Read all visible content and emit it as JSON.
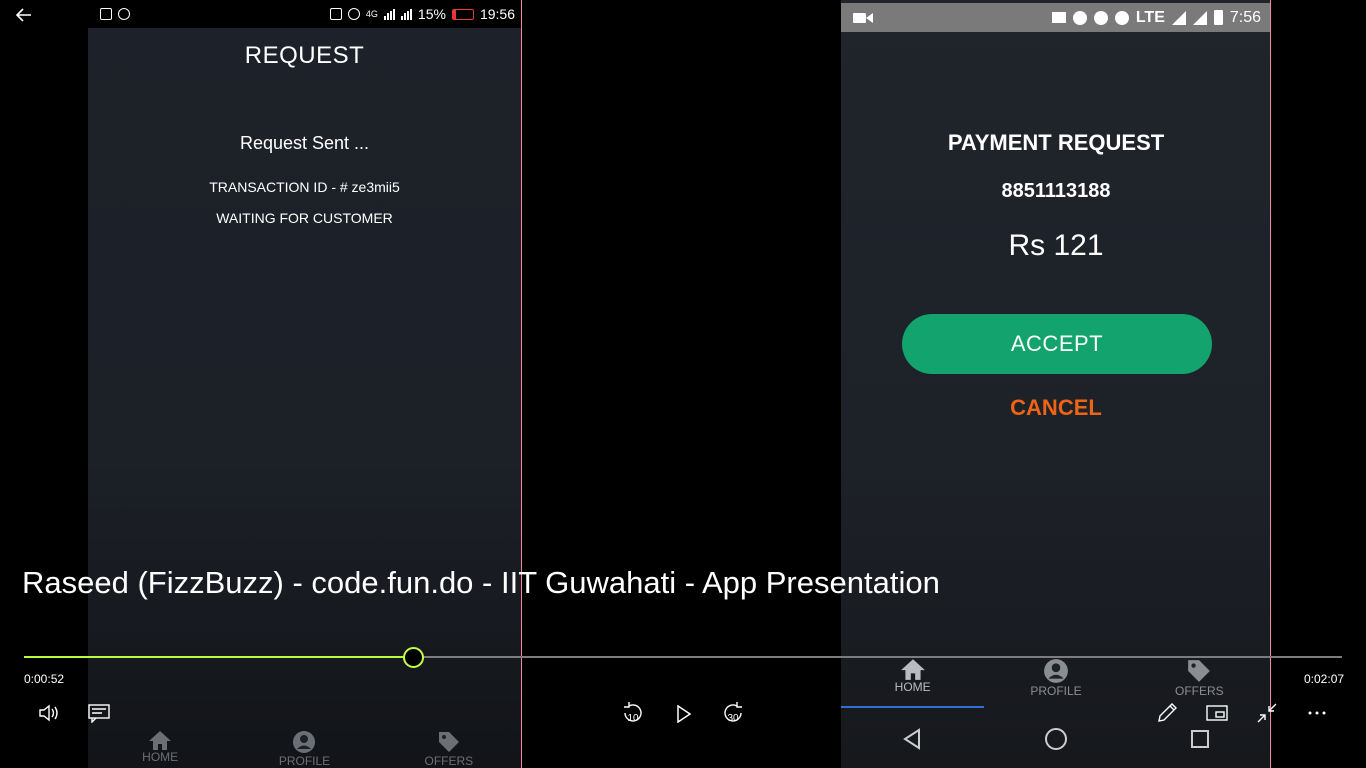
{
  "player": {
    "back_icon": "arrow-left-icon",
    "title": "Raseed (FizzBuzz) - code.fun.do - IIT Guwahati - App Presentation",
    "time_elapsed": "0:00:52",
    "time_total": "0:02:07",
    "progress_fraction": 0.2955,
    "accent_color": "#b6ff3c",
    "rewind_seconds": "10",
    "forward_seconds": "30",
    "controls": [
      "volume-icon",
      "captions-icon",
      "rewind-10-icon",
      "play-icon",
      "forward-30-icon",
      "pen-icon",
      "mini-view-icon",
      "exit-fullscreen-icon",
      "more-icon"
    ]
  },
  "left_phone": {
    "status": {
      "battery": "15%",
      "time": "19:56",
      "network": "4G"
    },
    "title": "REQUEST",
    "sent_text": "Request Sent ...",
    "transaction": "TRANSACTION ID - # ze3mii5",
    "waiting": "WAITING FOR CUSTOMER",
    "nav": [
      "HOME",
      "PROFILE",
      "OFFERS"
    ]
  },
  "right_phone": {
    "status": {
      "time": "7:56",
      "network": "LTE"
    },
    "title": "PAYMENT REQUEST",
    "phone_number": "8851113188",
    "amount": "Rs 121",
    "accept_label": "ACCEPT",
    "cancel_label": "CANCEL",
    "accept_color": "#12a36e",
    "cancel_color": "#ef6414",
    "nav": [
      "HOME",
      "PROFILE",
      "OFFERS"
    ]
  }
}
